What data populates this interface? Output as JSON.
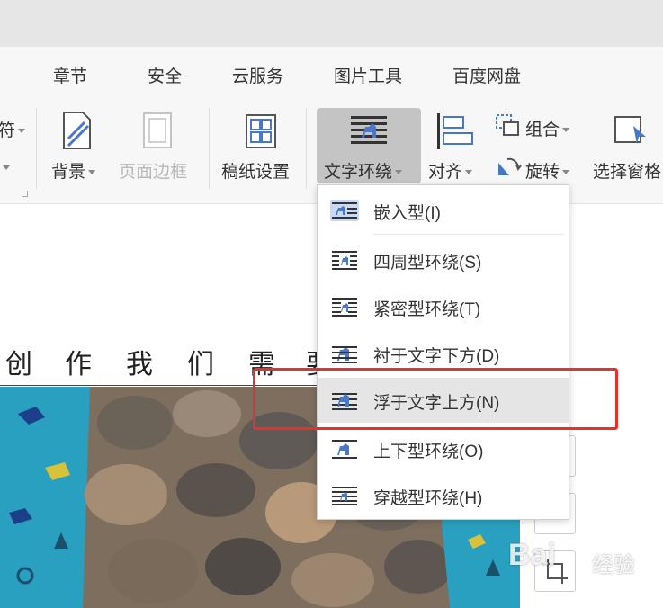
{
  "tabs": [
    "章节",
    "安全",
    "云服务",
    "图片工具",
    "百度网盘"
  ],
  "ribbon": {
    "partial_label": "符",
    "background_label": "背景",
    "page_border_label": "页面边框",
    "manuscript_label": "稿纸设置",
    "wrap_text_label": "文字环绕",
    "align_label": "对齐",
    "group_label": "组合",
    "rotate_label": "旋转",
    "selection_pane_label": "选择窗格"
  },
  "wrap_menu": {
    "items": [
      {
        "label": "嵌入型(I)",
        "selected": true
      },
      {
        "label": "四周型环绕(S)",
        "selected": false
      },
      {
        "label": "紧密型环绕(T)",
        "selected": false
      },
      {
        "label": "衬于文字下方(D)",
        "selected": false
      },
      {
        "label": "浮于文字上方(N)",
        "selected": false,
        "highlighted": true
      },
      {
        "label": "上下型环绕(O)",
        "selected": false
      },
      {
        "label": "穿越型环绕(H)",
        "selected": false
      }
    ]
  },
  "document": {
    "chars": [
      "创",
      "作",
      "我",
      "们",
      "需",
      "要"
    ]
  },
  "watermark": {
    "text": "Bai",
    "site": "经验"
  },
  "colors": {
    "accent": "#4a78c8",
    "highlight_box": "#e8302c"
  }
}
